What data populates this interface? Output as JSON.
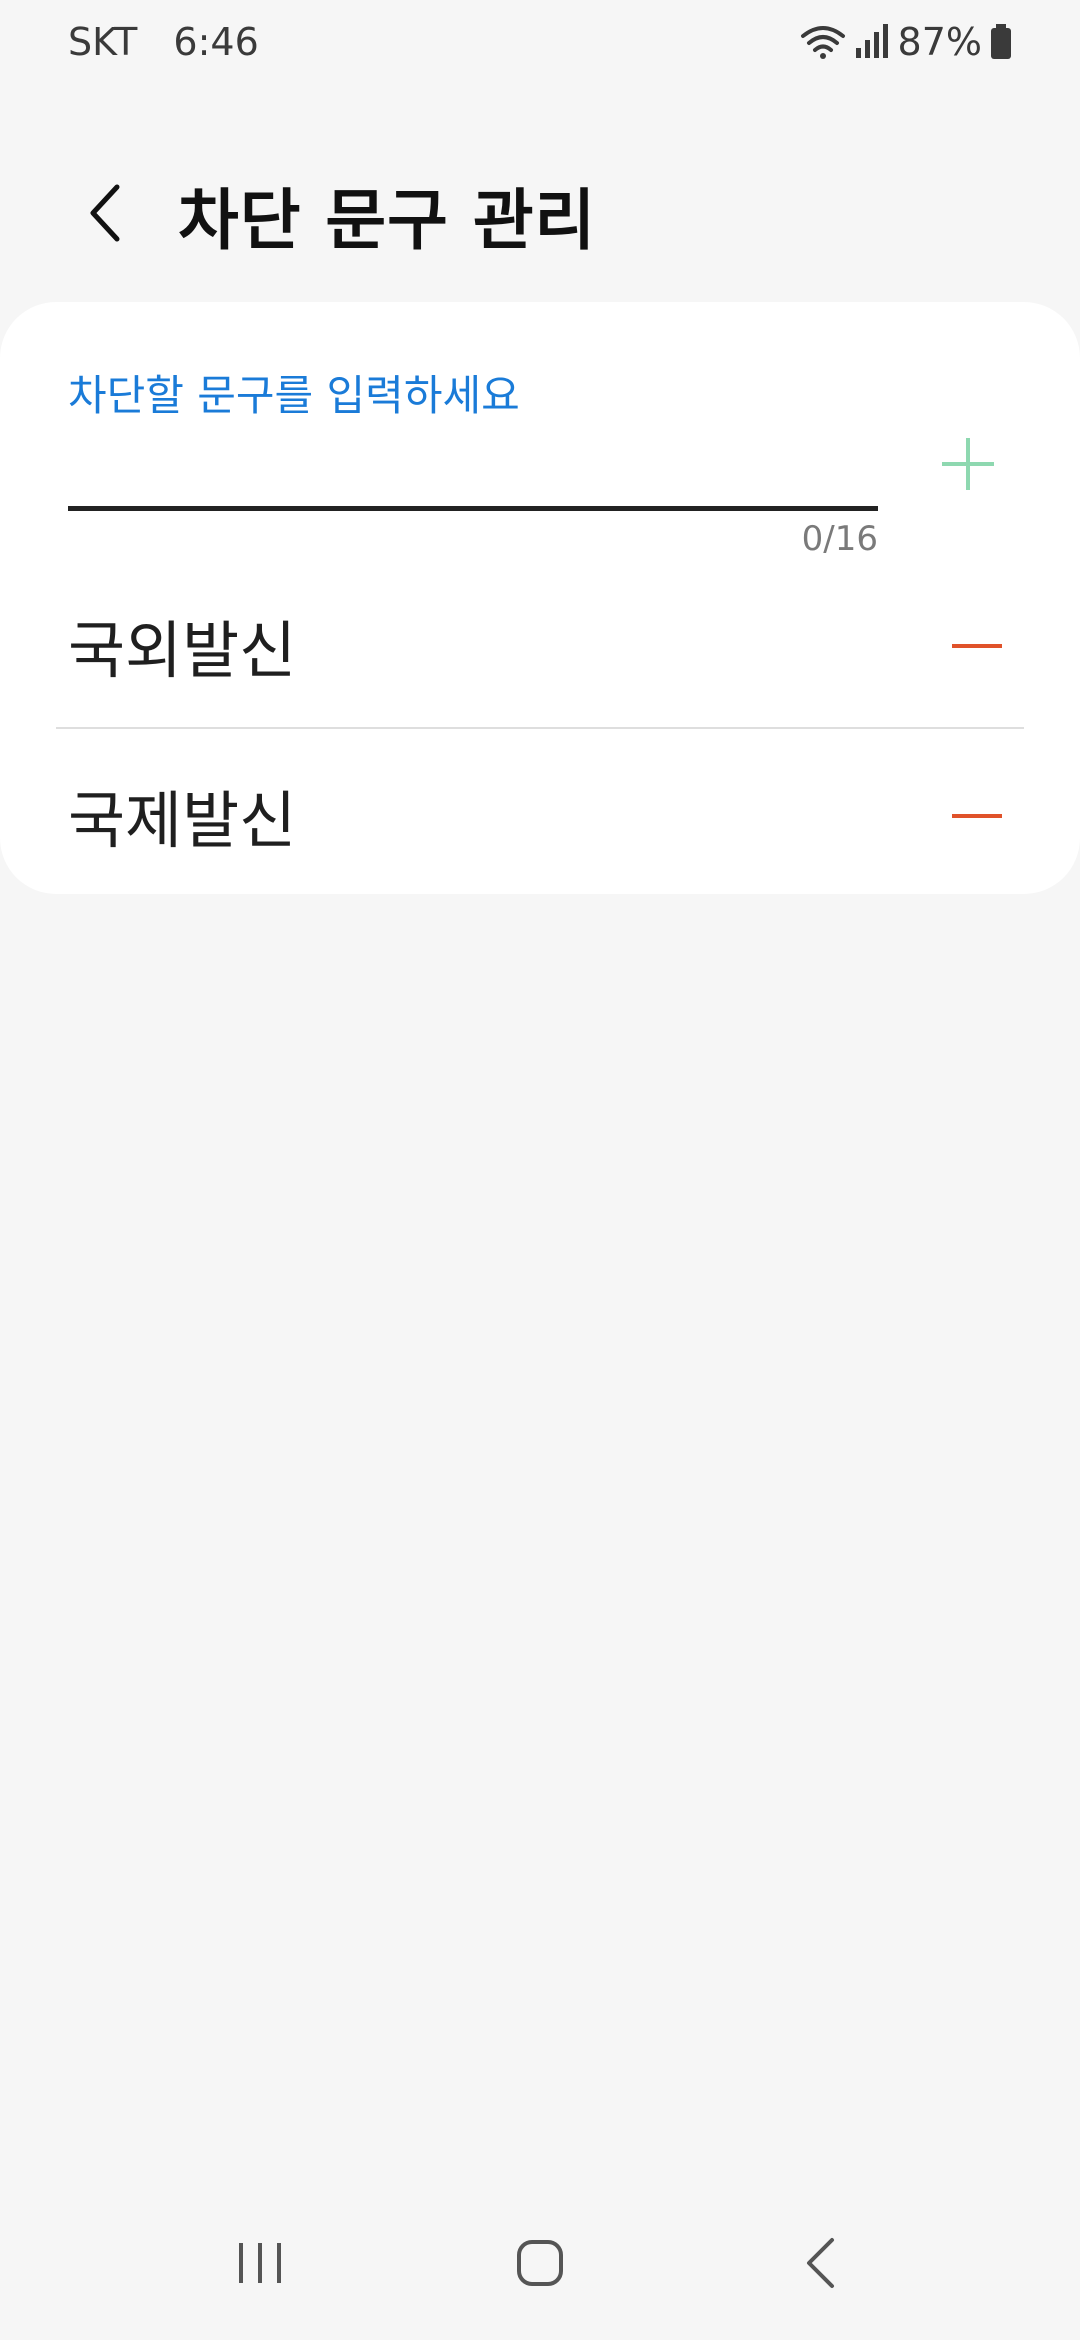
{
  "status_bar": {
    "carrier": "SKT",
    "time": "6:46",
    "battery": "87%",
    "icons": [
      "wifi-icon",
      "signal-icon",
      "battery-icon"
    ]
  },
  "header": {
    "title": "차단 문구 관리",
    "back_icon": "chevron-left-icon"
  },
  "input": {
    "label": "차단할 문구를 입력하세요",
    "value": "",
    "counter": "0/16",
    "add_icon": "plus-icon"
  },
  "blocked_phrases": [
    {
      "label": "국외발신",
      "remove_icon": "minus-icon"
    },
    {
      "label": "국제발신",
      "remove_icon": "minus-icon"
    }
  ],
  "nav_bar": {
    "icons": [
      "recents-icon",
      "home-icon",
      "back-icon"
    ]
  },
  "colors": {
    "accent_blue": "#1a7bd8",
    "add_green": "#8ed8b0",
    "remove_red": "#e0522a",
    "background": "#f6f6f6",
    "card": "#ffffff"
  }
}
